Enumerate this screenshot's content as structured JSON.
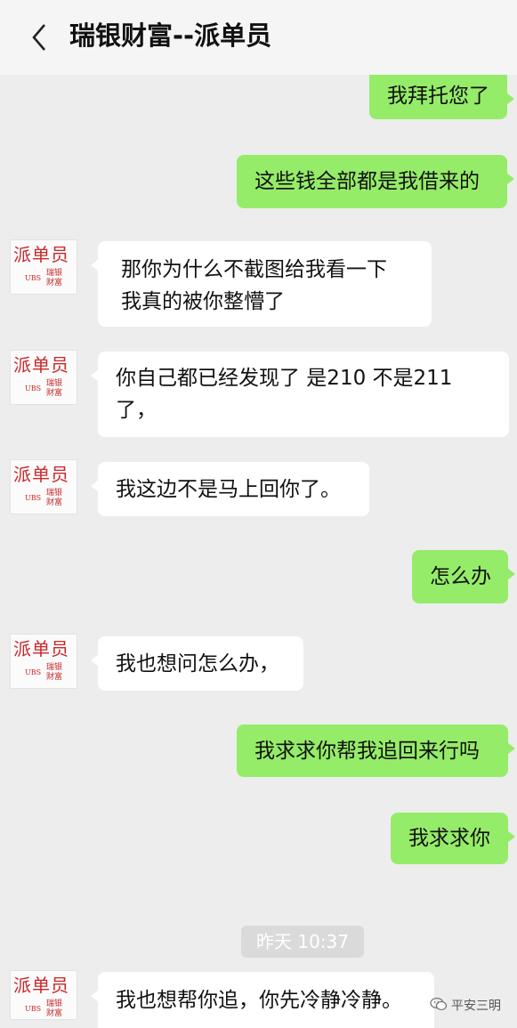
{
  "header": {
    "title": "瑞银财富--派单员",
    "back_icon": "chevron-left-icon"
  },
  "avatar": {
    "name_text": "派单员",
    "logo_text": "UBS",
    "sub_text": "瑞银财富"
  },
  "messages": [
    {
      "side": "me",
      "lines": [
        "我拜托您了"
      ]
    },
    {
      "side": "me",
      "lines": [
        "这些钱全部都是我借来的"
      ]
    },
    {
      "side": "them",
      "lines": [
        "那你为什么不截图给我看一下",
        "我真的被你整懵了"
      ]
    },
    {
      "side": "them",
      "lines": [
        "你自己都已经发现了 是210 不是211",
        "了，"
      ]
    },
    {
      "side": "them",
      "lines": [
        "我这边不是马上回你了。"
      ]
    },
    {
      "side": "me",
      "lines": [
        "怎么办"
      ]
    },
    {
      "side": "them",
      "lines": [
        "我也想问怎么办，"
      ]
    },
    {
      "side": "me",
      "lines": [
        "我求求你帮我追回来行吗"
      ]
    },
    {
      "side": "me",
      "lines": [
        "我求求你"
      ]
    },
    {
      "side": "them",
      "lines": [
        "我也想帮你追，你先冷静冷静。"
      ]
    }
  ],
  "timestamp": "昨天 10:37",
  "watermark": {
    "text": "平安三明",
    "icon": "wechat-icon"
  },
  "colors": {
    "sent_bubble": "#95ec69",
    "received_bubble": "#ffffff",
    "background": "#ededed",
    "avatar_text": "#c8282a"
  }
}
